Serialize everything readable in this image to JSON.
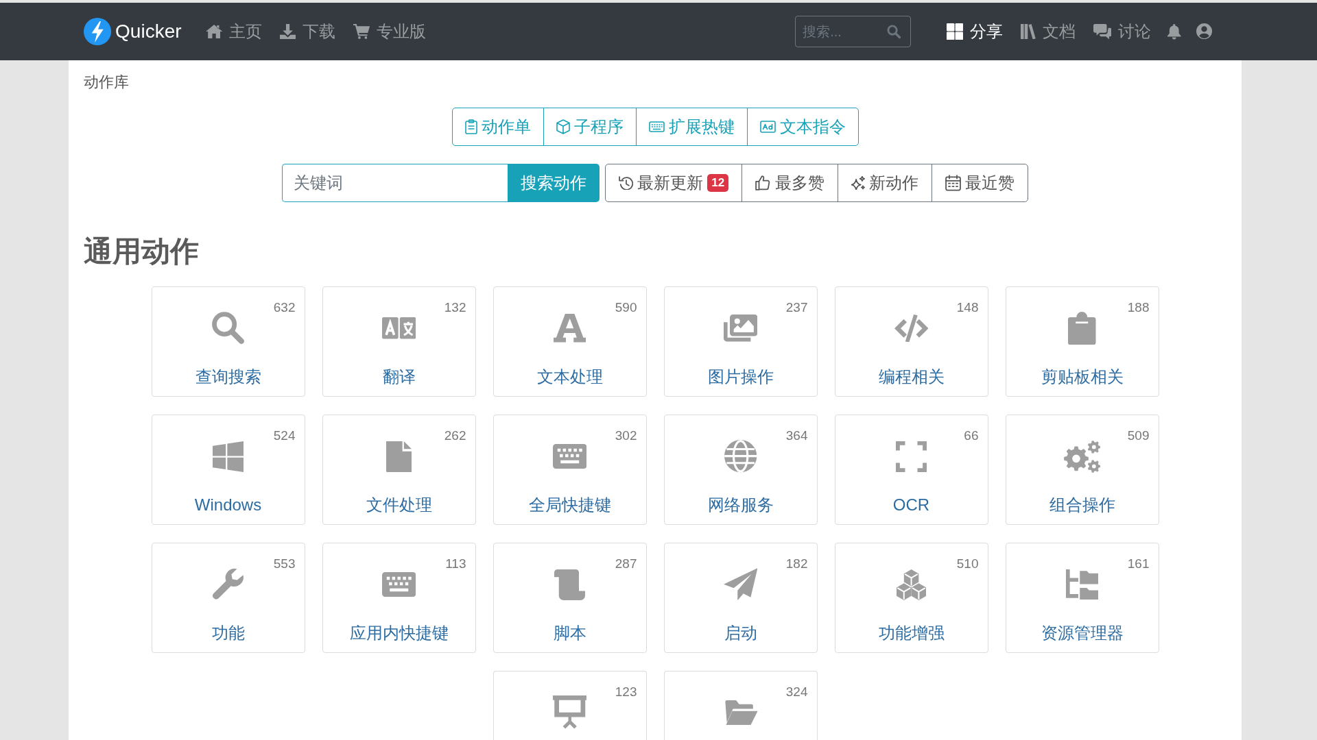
{
  "navbar": {
    "brand": "Quicker",
    "links": [
      {
        "label": "主页",
        "selected": false
      },
      {
        "label": "下载",
        "selected": false
      },
      {
        "label": "专业版",
        "selected": false
      }
    ],
    "search": {
      "placeholder": "搜索..."
    },
    "right_links": [
      {
        "label": "分享",
        "selected": true
      },
      {
        "label": "文档",
        "selected": false
      },
      {
        "label": "讨论",
        "selected": false
      }
    ]
  },
  "breadcrumb": "动作库",
  "type_tabs": [
    {
      "label": "动作单"
    },
    {
      "label": "子程序"
    },
    {
      "label": "扩展热键"
    },
    {
      "label": "文本指令"
    }
  ],
  "search": {
    "placeholder": "关键词",
    "button": "搜索动作"
  },
  "sort_buttons": [
    {
      "label": "最新更新",
      "badge": "12"
    },
    {
      "label": "最多赞"
    },
    {
      "label": "新动作"
    },
    {
      "label": "最近赞"
    }
  ],
  "section_title": "通用动作",
  "categories": [
    {
      "label": "查询搜索",
      "count": "632"
    },
    {
      "label": "翻译",
      "count": "132"
    },
    {
      "label": "文本处理",
      "count": "590"
    },
    {
      "label": "图片操作",
      "count": "237"
    },
    {
      "label": "编程相关",
      "count": "148"
    },
    {
      "label": "剪贴板相关",
      "count": "188"
    },
    {
      "label": "Windows",
      "count": "524"
    },
    {
      "label": "文件处理",
      "count": "262"
    },
    {
      "label": "全局快捷键",
      "count": "302"
    },
    {
      "label": "网络服务",
      "count": "364"
    },
    {
      "label": "OCR",
      "count": "66"
    },
    {
      "label": "组合操作",
      "count": "509"
    },
    {
      "label": "功能",
      "count": "553"
    },
    {
      "label": "应用内快捷键",
      "count": "113"
    },
    {
      "label": "脚本",
      "count": "287"
    },
    {
      "label": "启动",
      "count": "182"
    },
    {
      "label": "功能增强",
      "count": "510"
    },
    {
      "label": "资源管理器",
      "count": "161"
    },
    {
      "count": "123"
    },
    {
      "count": "324"
    }
  ]
}
